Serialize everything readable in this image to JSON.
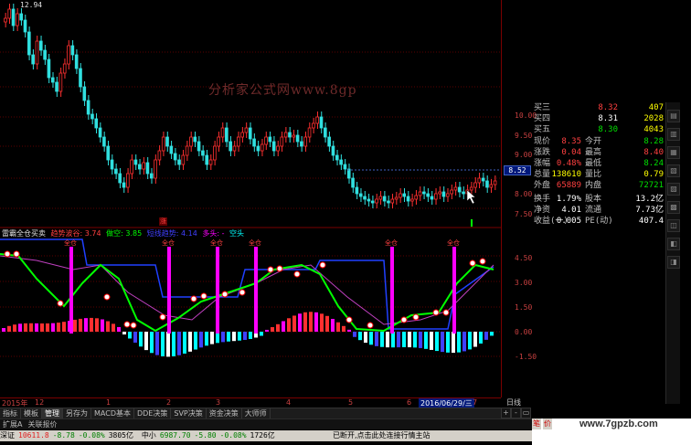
{
  "price_chart": {
    "high_label": "12.94",
    "axis_ticks": [
      "10.00",
      "9.50",
      "9.00",
      "8.50",
      "8.00",
      "7.50"
    ],
    "current_price": "8.52",
    "watermark": "分析家公式网www.8gp",
    "limit_up_marker": "涨",
    "colors": {
      "up": "#ff3030",
      "down": "#30e0e0",
      "grid": "#7a0000"
    }
  },
  "quote_panel": {
    "rows": [
      {
        "label": "买三",
        "price": "8.32",
        "vol": "407",
        "price_color": "#ff4040",
        "vol_color": "#ffff00"
      },
      {
        "label": "买四",
        "price": "8.31",
        "vol": "2028",
        "price_color": "#ffffff",
        "vol_color": "#ffff00"
      },
      {
        "label": "买五",
        "price": "8.30",
        "vol": "4043",
        "price_color": "#00e000",
        "vol_color": "#ffff00"
      },
      {
        "label": "现价",
        "price": "8.35",
        "label2": "今开",
        "value2": "8.28",
        "price_color": "#ff4040",
        "vol_color": "#00e000"
      },
      {
        "label": "涨跌",
        "price": "0.04",
        "label2": "最高",
        "value2": "8.40",
        "price_color": "#ff4040",
        "vol_color": "#ff4040"
      },
      {
        "label": "涨幅",
        "price": "0.48%",
        "label2": "最低",
        "value2": "8.24",
        "price_color": "#ff4040",
        "vol_color": "#00e000"
      },
      {
        "label": "总量",
        "price": "138610",
        "label2": "量比",
        "value2": "0.79",
        "price_color": "#ffff00",
        "vol_color": "#ffff00"
      },
      {
        "label": "外盘",
        "price": "65889",
        "label2": "内盘",
        "value2": "72721",
        "price_color": "#ff4040",
        "vol_color": "#00e000"
      },
      {
        "label": "换手",
        "price": "1.79%",
        "label2": "股本",
        "value2": "13.2亿",
        "price_color": "#ffffff",
        "vol_color": "#ffffff"
      },
      {
        "label": "净资",
        "price": "4.01",
        "label2": "流通",
        "value2": "7.73亿",
        "price_color": "#ffffff",
        "vol_color": "#ffffff"
      },
      {
        "label": "收益(一)",
        "price": "0.005",
        "label2": "PE(动)",
        "value2": "407.4",
        "price_color": "#ffffff",
        "vol_color": "#ffffff"
      }
    ]
  },
  "indicator": {
    "name": "雷霸全仓买卖",
    "params": [
      {
        "label": "趋势波谷: 3.74",
        "color": "#ff4040"
      },
      {
        "label": "做空: 3.85",
        "color": "#00ff00"
      },
      {
        "label": "短线趋势: 4.14",
        "color": "#4040ff"
      },
      {
        "label": "多头: -",
        "color": "#ff00ff"
      },
      {
        "label": "空头",
        "color": "#00ffff"
      }
    ],
    "signal_label": "全仓",
    "axis_ticks": [
      "4.50",
      "3.00",
      "1.50",
      "0.00",
      "-1.50"
    ]
  },
  "date_axis": {
    "labels": [
      "2015年",
      "12",
      "1",
      "2",
      "3",
      "4",
      "5",
      "6",
      "7"
    ],
    "highlight": "2016/06/29/三",
    "period": "日线"
  },
  "indicator_bar": {
    "buttons": [
      "指标",
      "模板",
      "管理",
      "另存为",
      "MACD基本",
      "DDE决策",
      "SVP决策",
      "资金决策",
      "大师师"
    ]
  },
  "nav": {
    "buttons": [
      "+",
      "-",
      "▭"
    ]
  },
  "tabs": {
    "items": [
      "扩展A",
      "关联报价"
    ]
  },
  "status_bar": {
    "index1_name": "深证",
    "index1_value": "10611.8",
    "index1_change": "-8.78",
    "index1_pct": "-0.08%",
    "index1_amount": "3805亿",
    "index2_name": "中小",
    "index2_value": "6987.70",
    "index2_change": "-5.80",
    "index2_pct": "-0.08%",
    "index2_amount": "1726亿",
    "message": "已断开,点击此处连接行情主站"
  },
  "side_tabs": [
    "笔",
    "价"
  ],
  "site_mark": "www.7gpzb.com"
}
